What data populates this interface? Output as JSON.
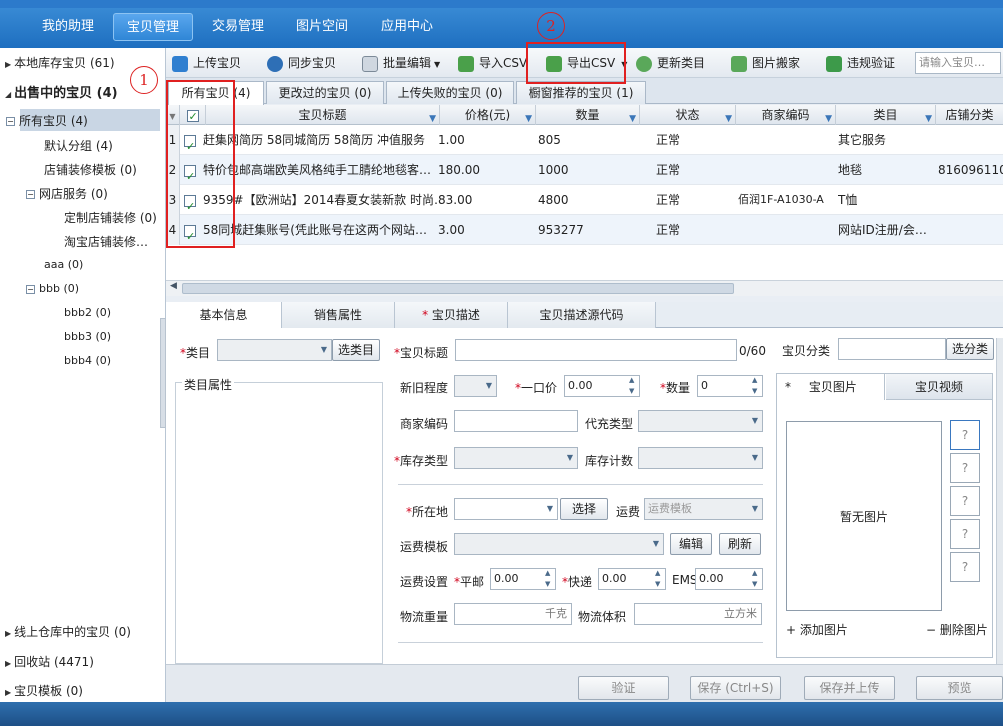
{
  "nav": {
    "tabs": [
      "我的助理",
      "宝贝管理",
      "交易管理",
      "图片空间",
      "应用中心"
    ],
    "active_index": 1
  },
  "tree": {
    "local_stock": "本地库存宝贝 (61)",
    "on_sale": "出售中的宝贝 (4)",
    "all_items": "所有宝贝 (4)",
    "default_group": "默认分组 (4)",
    "shop_template": "店铺装修模板 (0)",
    "shop_service": "网店服务 (0)",
    "custom_decor": "定制店铺装修 (0)",
    "taobao_decor": "淘宝店铺装修…",
    "aaa": "aaa (0)",
    "bbb": "bbb (0)",
    "bbb2": "bbb2 (0)",
    "bbb3": "bbb3 (0)",
    "bbb4": "bbb4 (0)",
    "warehouse": "线上仓库中的宝贝 (0)",
    "recycle": "回收站 (4471)",
    "templates": "宝贝模板 (0)"
  },
  "toolbar": {
    "upload": "上传宝贝",
    "sync": "同步宝贝",
    "batch_edit": "批量编辑",
    "import_csv": "导入CSV",
    "export_csv": "导出CSV",
    "update_category": "更新类目",
    "image_move": "图片搬家",
    "violation_check": "违规验证",
    "search_placeholder": "请输入宝贝…"
  },
  "subtabs": [
    "所有宝贝 (4)",
    "更改过的宝贝 (0)",
    "上传失败的宝贝 (0)",
    "橱窗推荐的宝贝 (1)"
  ],
  "grid": {
    "columns": [
      "宝贝标题",
      "价格(元)",
      "数量",
      "状态",
      "商家编码",
      "类目",
      "店铺分类"
    ],
    "rows": [
      {
        "n": "1",
        "title": "赶集网简历 58同城简历 58简历 冲值服务",
        "price": "1.00",
        "qty": "805",
        "status": "正常",
        "code": "",
        "cat": "其它服务",
        "shopcat": ""
      },
      {
        "n": "2",
        "title": "特价包邮高端欧美风格纯手工腈纶地毯客…",
        "price": "180.00",
        "qty": "1000",
        "status": "正常",
        "code": "",
        "cat": "地毯",
        "shopcat": "816096110"
      },
      {
        "n": "3",
        "title": "9359#【欧洲站】2014春夏女装新款 时尚…",
        "price": "83.00",
        "qty": "4800",
        "status": "正常",
        "code": "佰润1F-A1030-A",
        "cat": "T恤",
        "shopcat": ""
      },
      {
        "n": "4",
        "title": "58同城赶集账号(凭此账号在这两个网站…",
        "price": "3.00",
        "qty": "953277",
        "status": "正常",
        "code": "",
        "cat": "网站ID注册/会…",
        "shopcat": ""
      }
    ]
  },
  "detail_tabs": [
    "基本信息",
    "销售属性",
    "宝贝描述",
    "宝贝描述源代码"
  ],
  "detail_tab_required_mark": "*",
  "form": {
    "category": "类目",
    "choose_category": "选类目",
    "title": "宝贝标题",
    "title_count": "0/60",
    "item_class": "宝贝分类",
    "choose_class": "选分类",
    "category_attrs": "类目属性",
    "condition": "新旧程度",
    "price": "一口价",
    "price_val": "0.00",
    "qty": "数量",
    "qty_val": "0",
    "merchant_code": "商家编码",
    "fill_type": "代充类型",
    "stock_type": "库存类型",
    "stock_count": "库存计数",
    "location": "所在地",
    "choose": "选择",
    "freight": "运费",
    "freight_tpl_placeholder": "运费模板",
    "freight_template": "运费模板",
    "edit": "编辑",
    "refresh": "刷新",
    "freight_setting": "运费设置",
    "surface": "平邮",
    "express": "快递",
    "ems": "EMS",
    "zero": "0.00",
    "weight": "物流重量",
    "weight_unit": "千克",
    "volume": "物流体积",
    "volume_unit": "立方米",
    "pics_tab": "宝贝图片",
    "video_tab": "宝贝视频",
    "no_image": "暂无图片",
    "add_image": "添加图片",
    "del_image": "删除图片",
    "slot": "?",
    "required_mark": "*"
  },
  "bottom": {
    "validate": "验证",
    "save": "保存 (Ctrl+S)",
    "save_upload": "保存并上传",
    "preview": "预览"
  },
  "annotations": {
    "one": "1",
    "two": "2"
  }
}
